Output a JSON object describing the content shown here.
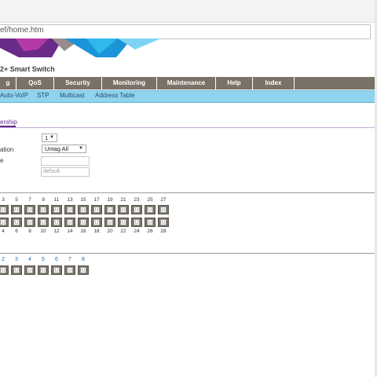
{
  "browser": {
    "url": "ef/home.htm"
  },
  "header": {
    "product_title": "2+ Smart Switch"
  },
  "nav": {
    "items": [
      {
        "label": "g",
        "w": 21
      },
      {
        "label": "QoS",
        "w": 48
      },
      {
        "label": "Security",
        "w": 61
      },
      {
        "label": "Monitoring",
        "w": 70
      },
      {
        "label": "Maintenance",
        "w": 75
      },
      {
        "label": "Help",
        "w": 47
      },
      {
        "label": "Index",
        "w": 53
      }
    ]
  },
  "subnav": {
    "items": [
      "Auto-VoIP",
      "STP",
      "Multicast",
      "Address Table"
    ]
  },
  "tab": {
    "label": "ership"
  },
  "form": {
    "vlan_select_value": "1",
    "tagging_label": "ation",
    "tagging_select_value": "Untag All",
    "name_label": "e",
    "name_value": "",
    "name_placeholder": "default"
  },
  "ports": {
    "top_numbers": [
      "3",
      "5",
      "7",
      "9",
      "11",
      "13",
      "15",
      "17",
      "19",
      "21",
      "23",
      "25",
      "27"
    ],
    "bottom_numbers": [
      "4",
      "6",
      "8",
      "10",
      "12",
      "14",
      "16",
      "18",
      "20",
      "22",
      "24",
      "26",
      "28"
    ],
    "state_letter": "U"
  },
  "lags": {
    "numbers": [
      "2",
      "3",
      "4",
      "5",
      "6",
      "7",
      "8"
    ],
    "state_letter": "U"
  },
  "colors": {
    "nav_bg": "#7a7267",
    "subnav_bg": "#8fd4ee",
    "accent_purple": "#5b2c83",
    "link_blue": "#1f6fb5"
  }
}
